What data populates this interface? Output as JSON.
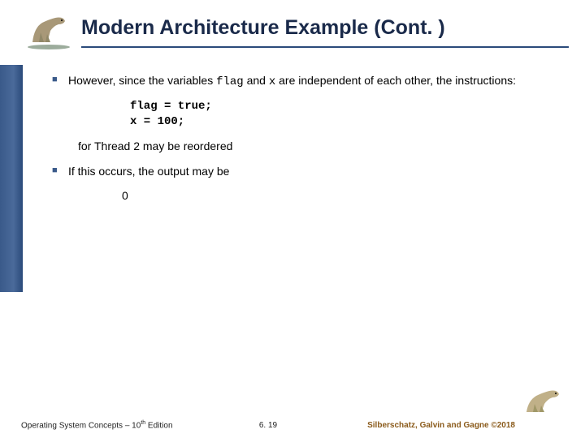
{
  "header": {
    "title": "Modern Architecture Example (Cont. )"
  },
  "bullets": {
    "b1_part1": "However, since the variables ",
    "b1_code1": "flag",
    "b1_part2": " and ",
    "b1_code2": "x",
    "b1_part3": " are independent of each other, the instructions:",
    "code_line1": "flag = true;",
    "code_line2": "x = 100;",
    "sub1": "for Thread 2 may be reordered",
    "b2": "If this occurs, the output may be",
    "zero": "0"
  },
  "footer": {
    "left_prefix": "Operating System Concepts – 10",
    "left_sup": "th",
    "left_suffix": " Edition",
    "center": "6. 19",
    "right_prefix": "Silberschatz, Galvin and Gagne ",
    "right_copy": "©",
    "right_year": "2018"
  },
  "icons": {
    "top_logo": "dinosaur-logo",
    "bottom_logo": "dinosaur-logo-small"
  }
}
